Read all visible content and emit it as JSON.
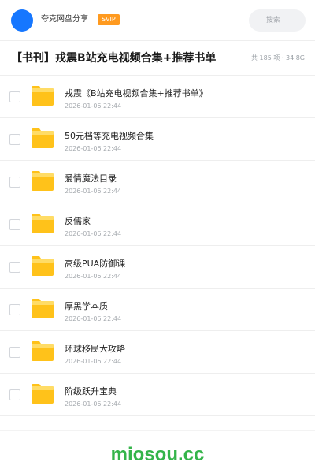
{
  "header": {
    "brand": "夸克网盘分享",
    "vip_badge": "SVIP",
    "search_placeholder": "搜索",
    "avatar_color": "#1677ff"
  },
  "share": {
    "title": "【书刊】戎震B站充电视频合集+推荐书单",
    "summary": "共 185 项 · 34.8G"
  },
  "files": [
    {
      "name": "戎震《B站充电视频合集+推荐书单》",
      "date": "2026-01-06 22:44",
      "icon": "folder-icon"
    },
    {
      "name": "50元档等充电视频合集",
      "date": "2026-01-06 22:44",
      "icon": "folder-icon"
    },
    {
      "name": "爱情魔法目录",
      "date": "2026-01-06 22:44",
      "icon": "folder-icon"
    },
    {
      "name": "反儒家",
      "date": "2026-01-06 22:44",
      "icon": "folder-icon"
    },
    {
      "name": "高级PUA防御课",
      "date": "2026-01-06 22:44",
      "icon": "folder-icon"
    },
    {
      "name": "厚黑学本质",
      "date": "2026-01-06 22:44",
      "icon": "folder-icon"
    },
    {
      "name": "环球移民大攻略",
      "date": "2026-01-06 22:44",
      "icon": "folder-icon"
    },
    {
      "name": "阶级跃升宝典",
      "date": "2026-01-06 22:44",
      "icon": "folder-icon"
    }
  ],
  "footer": {
    "watermark": "miosou.cc",
    "watermark_color": "#34b44a"
  },
  "colors": {
    "folder": "#ffc21a",
    "folder_tab": "#ffdc66"
  }
}
